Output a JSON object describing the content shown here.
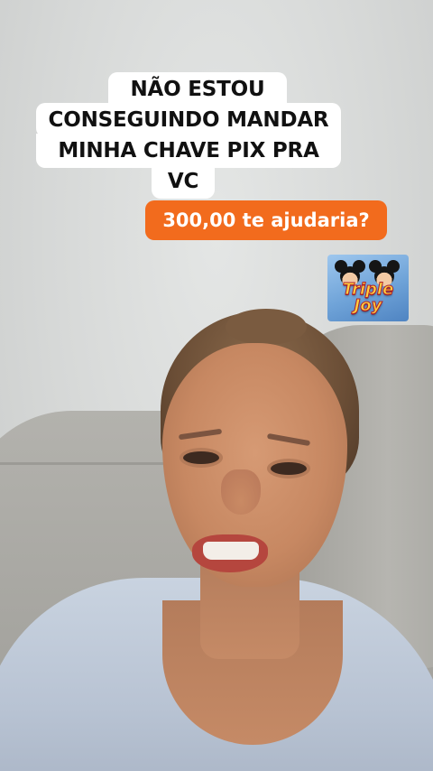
{
  "caption": {
    "line1": "NÃO ESTOU",
    "line2": "CONSEGUINDO MANDAR",
    "line3": "MINHA CHAVE PIX PRA",
    "line4": "VC"
  },
  "reply": {
    "text": "300,00 te ajudaria?"
  },
  "sticker": {
    "title_line1": "Triple",
    "title_line2": "Joy",
    "icon": "mickey-mouse-icon"
  },
  "colors": {
    "reply_bubble": "#f26b1d",
    "caption_bg": "#ffffff",
    "sticker_title": "#ffd23f"
  }
}
